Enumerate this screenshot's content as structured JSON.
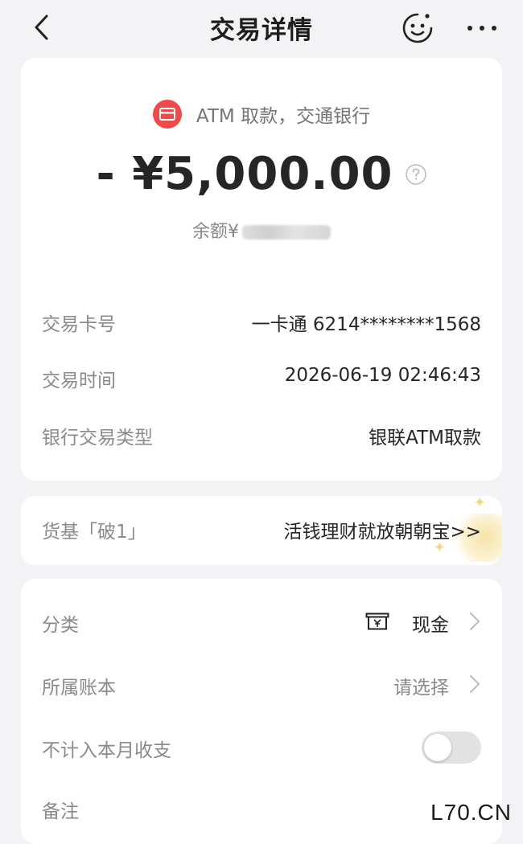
{
  "header": {
    "title": "交易详情"
  },
  "transaction": {
    "merchant": "ATM 取款，交通银行",
    "amount": "- ¥5,000.00",
    "balance_label": "余额",
    "balance_currency": "¥",
    "balance_value_hidden": "blurred",
    "card_label": "交易卡号",
    "card_value": "一卡通 6214********1568",
    "time_label": "交易时间",
    "time_value": "2026-06-19 02:46:43",
    "type_label": "银行交易类型",
    "type_value": "银联ATM取款"
  },
  "promo": {
    "label": "货基「破1」",
    "link": "活钱理财就放朝朝宝>>"
  },
  "details": {
    "category_label": "分类",
    "category_value": "现金",
    "ledger_label": "所属账本",
    "ledger_value": "请选择",
    "exclude_label": "不计入本月收支",
    "exclude_enabled": false,
    "note_label": "备注"
  },
  "watermark": "L70.CN",
  "icons": {
    "back": "chevron-left-icon",
    "assistant": "smile-face-icon",
    "more": "more-dots-icon",
    "merchant": "card-icon",
    "help": "question-circle-icon",
    "cash": "cash-yen-icon",
    "chevron": "chevron-right-icon"
  },
  "colors": {
    "merchant_icon_bg": "#ef4a4a",
    "page_bg": "#f3f3f5",
    "toggle_off": "#e2e2e2"
  }
}
